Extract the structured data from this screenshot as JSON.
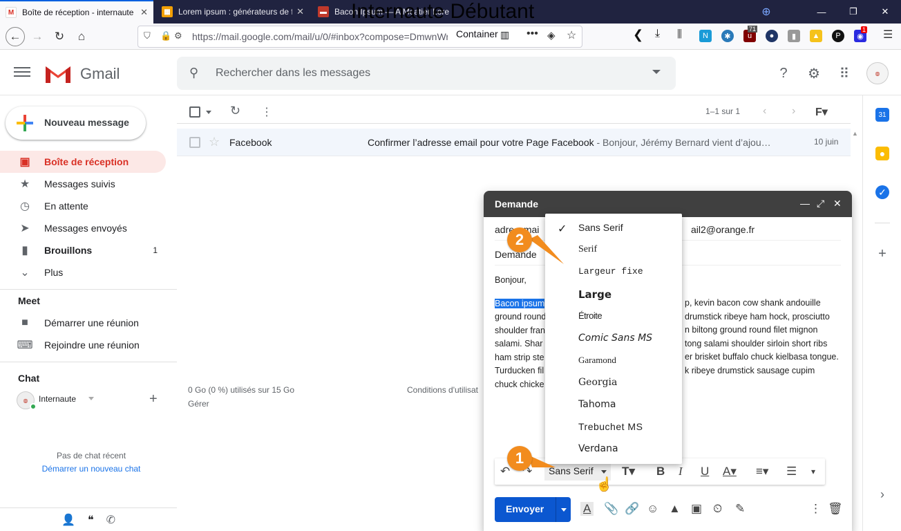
{
  "browser": {
    "tabs": [
      {
        "label": "Boîte de réception - internaute",
        "active": true,
        "favicon": "gmail-icon"
      },
      {
        "label": "Lorem ipsum : générateurs de f",
        "active": false,
        "favicon": "grid-icon"
      },
      {
        "label": "Bacon Ipsum — A Meatier Lore",
        "active": false,
        "favicon": "bacon-icon"
      }
    ],
    "watermark": "Internaute Débutant",
    "url": "https://mail.google.com/mail/u/0/#inbox?compose=DmwnWr",
    "url_host": "mail.google.com",
    "container": "Container",
    "ext_badges": {
      "counter": "71",
      "notif": "1"
    }
  },
  "gmail": {
    "product": "Gmail",
    "search_placeholder": "Rechercher dans les messages",
    "compose_label": "Nouveau message",
    "nav": [
      {
        "label": "Boîte de réception",
        "icon": "inbox-icon",
        "active": true,
        "count": ""
      },
      {
        "label": "Messages suivis",
        "icon": "star-icon",
        "active": false,
        "count": ""
      },
      {
        "label": "En attente",
        "icon": "clock-icon",
        "active": false,
        "count": ""
      },
      {
        "label": "Messages envoyés",
        "icon": "send-icon",
        "active": false,
        "count": ""
      },
      {
        "label": "Brouillons",
        "icon": "draft-icon",
        "active": false,
        "count": "1"
      },
      {
        "label": "Plus",
        "icon": "chevron-down-icon",
        "active": false,
        "count": ""
      }
    ],
    "meet": {
      "title": "Meet",
      "items": [
        "Démarrer une réunion",
        "Rejoindre une réunion"
      ]
    },
    "chat": {
      "title": "Chat",
      "user": "Internaute",
      "empty": "Pas de chat récent",
      "start": "Démarrer un nouveau chat"
    },
    "toolbar": {
      "pagination": "1–1 sur 1"
    },
    "emails": [
      {
        "from": "Facebook",
        "subject": "Confirmer l’adresse email pour votre Page Facebook",
        "snippet": " - Bonjour, Jérémy Bernard vient d’ajou…",
        "date": "10 juin"
      }
    ],
    "footer": {
      "storage": "0 Go (0 %) utilisés sur 15 Go",
      "manage": "Gérer",
      "terms": "Conditions d'utilisat"
    }
  },
  "compose": {
    "title": "Demande",
    "to_start": "adre",
    "to_mid": "emai",
    "to_end": "ail2@orange.fr",
    "subject": "Demande",
    "greeting": "Bonjour,",
    "body_selected": "Bacon ipsum",
    "body_lines_left": [
      "ground round",
      "shoulder fran",
      "salami. Shar",
      "ham strip ste",
      "Turducken fil",
      "chuck chicke"
    ],
    "body_lines_right": [
      "p, kevin bacon cow shank andouille",
      "drumstick ribeye ham hock, prosciutto",
      "n biltong ground round filet mignon",
      "tong salami shoulder sirloin short ribs",
      "er brisket buffalo chuck kielbasa tongue.",
      "k ribeye drumstick sausage cupim"
    ],
    "font_current": "Sans Serif",
    "send_label": "Envoyer"
  },
  "font_menu": {
    "selected": "Sans Serif",
    "options": [
      "Sans Serif",
      "Serif",
      "Largeur fixe",
      "Large",
      "Étroite",
      "Comic Sans MS",
      "Garamond",
      "Georgia",
      "Tahoma",
      "Trebuchet MS",
      "Verdana"
    ]
  },
  "callouts": {
    "one": "1",
    "two": "2"
  },
  "colors": {
    "gmail_red": "#d93025",
    "accent_blue": "#0b57d0",
    "callout_orange": "#f28c1e"
  }
}
